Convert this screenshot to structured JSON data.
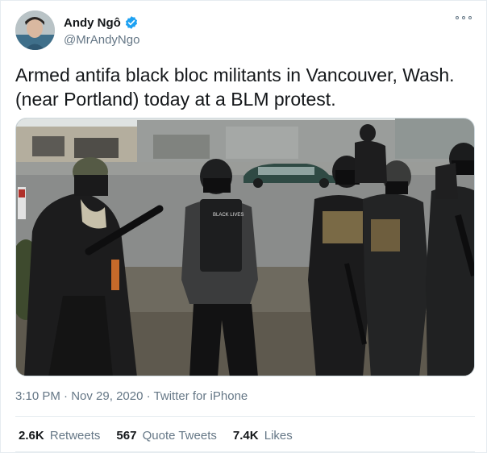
{
  "author": {
    "display_name": "Andy Ngô",
    "handle": "@MrAndyNgo",
    "verified": true
  },
  "tweet": {
    "text_line1": "Armed antifa black bloc militants in Vancouver, Wash.",
    "text_line2": "(near Portland) today at a BLM protest."
  },
  "meta": {
    "time": "3:10 PM",
    "separator1": "·",
    "date": "Nov 29, 2020",
    "separator2": "·",
    "source": "Twitter for iPhone"
  },
  "stats": {
    "retweets_count": "2.6K",
    "retweets_label": "Retweets",
    "quote_count": "567",
    "quote_label": "Quote Tweets",
    "likes_count": "7.4K",
    "likes_label": "Likes"
  },
  "colors": {
    "verified_blue": "#1da1f2",
    "secondary_text": "#657786",
    "primary_text": "#14171a",
    "border": "#e6ecf0"
  },
  "photo_text": {
    "vest_patch": "BLACK LIVES"
  }
}
